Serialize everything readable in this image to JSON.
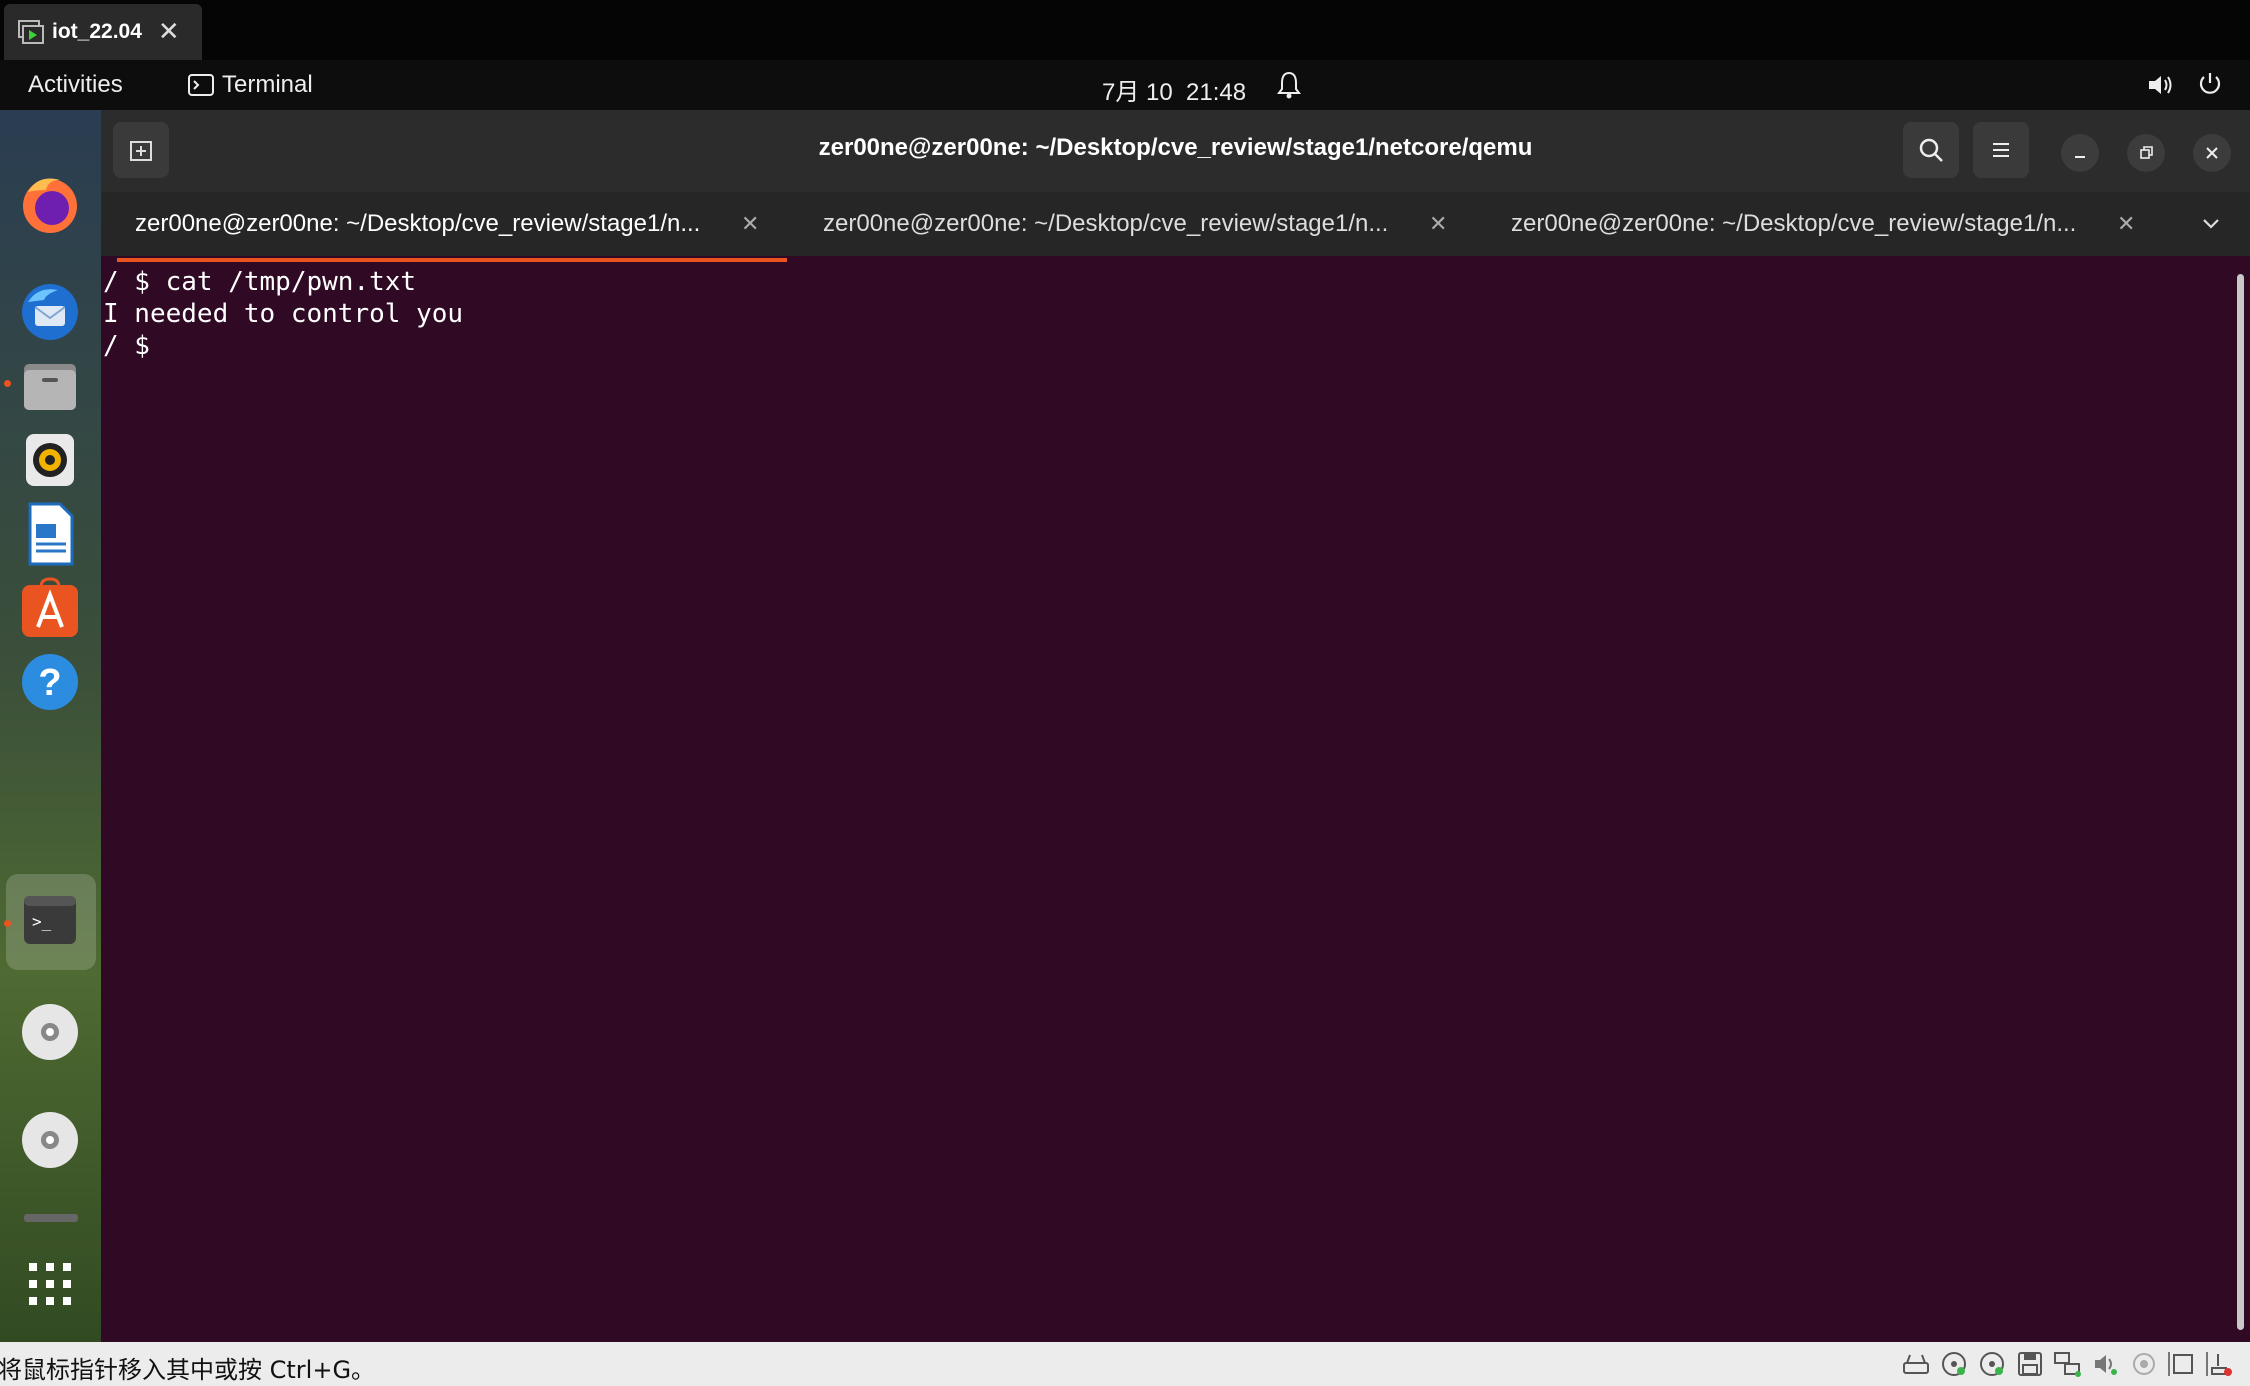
{
  "vm": {
    "tab_title": "iot_22.04",
    "status_text": "将鼠标指针移入其中或按 Ctrl+G。",
    "status_icons": [
      "hard-disk-icon",
      "cd-drive-icon",
      "cd-drive-icon",
      "floppy-save-icon",
      "network-icon",
      "audio-icon",
      "usb-icon",
      "display-icon",
      "device-error-icon"
    ]
  },
  "topbar": {
    "activities": "Activities",
    "app_name": "Terminal",
    "clock": "7月 10  21:48"
  },
  "dock": {
    "items": [
      "firefox-icon",
      "thunderbird-icon",
      "files-icon",
      "rhythmbox-icon",
      "writer-icon",
      "app-center-icon",
      "help-icon",
      "terminal-icon",
      "disc-icon",
      "disc-icon",
      "show-apps-icon"
    ]
  },
  "terminal": {
    "window_title": "zer00ne@zer00ne: ~/Desktop/cve_review/stage1/netcore/qemu",
    "tabs": [
      {
        "label": "zer00ne@zer00ne: ~/Desktop/cve_review/stage1/n..."
      },
      {
        "label": "zer00ne@zer00ne: ~/Desktop/cve_review/stage1/n..."
      },
      {
        "label": "zer00ne@zer00ne: ~/Desktop/cve_review/stage1/n..."
      }
    ],
    "lines": [
      "/ $ cat /tmp/pwn.txt",
      "I needed to control you",
      "/ $ "
    ]
  },
  "colors": {
    "terminal_bg": "#300a24",
    "accent": "#e95420",
    "headerbar": "#2c2c2c"
  }
}
